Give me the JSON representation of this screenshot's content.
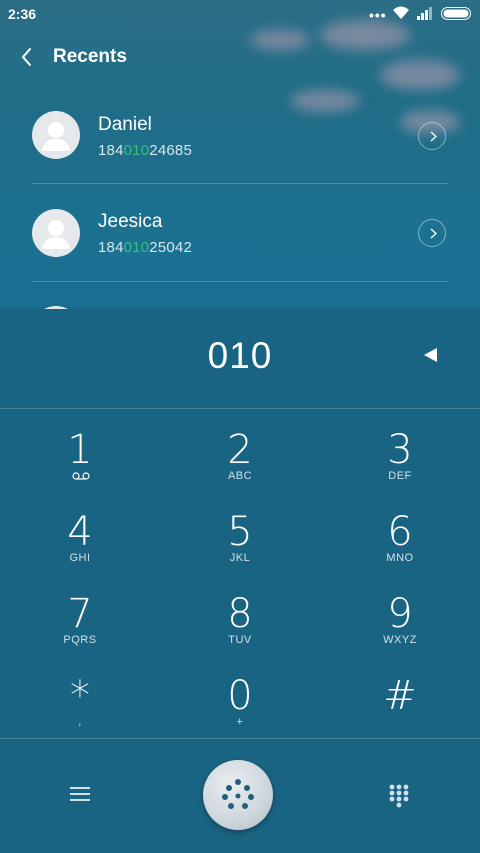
{
  "status_bar": {
    "time": "2:36",
    "dots": "•••"
  },
  "header": {
    "title": "Recents"
  },
  "recents": [
    {
      "name": "Daniel",
      "number_before": "184",
      "number_match": "010",
      "number_after": "24685"
    },
    {
      "name": "Jeesica",
      "number_before": "184",
      "number_match": "010",
      "number_after": "25042"
    }
  ],
  "dialer": {
    "entered": "010",
    "keys": [
      {
        "digit": "1",
        "letters": ""
      },
      {
        "digit": "2",
        "letters": "ABC"
      },
      {
        "digit": "3",
        "letters": "DEF"
      },
      {
        "digit": "4",
        "letters": "GHI"
      },
      {
        "digit": "5",
        "letters": "JKL"
      },
      {
        "digit": "6",
        "letters": "MNO"
      },
      {
        "digit": "7",
        "letters": "PQRS"
      },
      {
        "digit": "8",
        "letters": "TUV"
      },
      {
        "digit": "9",
        "letters": "WXYZ"
      },
      {
        "digit": "*",
        "letters": ","
      },
      {
        "digit": "0",
        "letters": "+"
      },
      {
        "digit": "#",
        "letters": ""
      }
    ]
  },
  "icons": {
    "back": "back-arrow-icon",
    "info": "chevron-right-icon",
    "backspace": "backspace-triangle-icon",
    "voicemail": "voicemail-icon",
    "menu": "menu-icon",
    "dial": "dial-dots-icon",
    "keypad": "keypad-icon"
  },
  "colors": {
    "accent_match": "#39c17a",
    "panel": "#1a6483"
  }
}
